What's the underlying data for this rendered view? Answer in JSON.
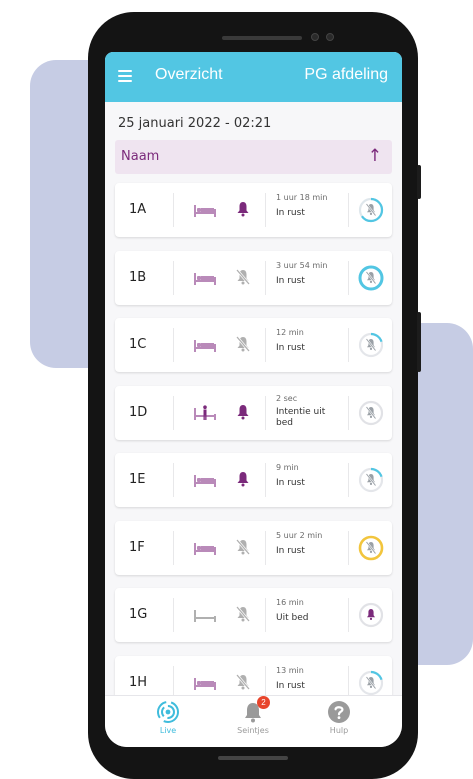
{
  "app": {
    "title": "Overzicht",
    "department": "PG afdeling"
  },
  "datetime": "25 januari 2022 - 02:21",
  "sort": {
    "label": "Naam",
    "direction_icon": "arrow-up-icon"
  },
  "colors": {
    "primary": "#52c6e3",
    "accent": "#7b2a7b",
    "ring_default": "#52c6e3",
    "ring_alert": "#f2c53d",
    "badge": "#e8452c"
  },
  "rooms": [
    {
      "name": "1A",
      "bed": "bed-occupied",
      "bell": "active",
      "duration": "1 uur 18 min",
      "status": "In rust",
      "ring": "blue-thin"
    },
    {
      "name": "1B",
      "bed": "bed-occupied",
      "bell": "muted",
      "duration": "3 uur 54 min",
      "status": "In rust",
      "ring": "blue-thick"
    },
    {
      "name": "1C",
      "bed": "bed-occupied",
      "bell": "muted",
      "duration": "12 min",
      "status": "In rust",
      "ring": "blue-partial"
    },
    {
      "name": "1D",
      "bed": "person-out-of-bed",
      "bell": "active",
      "duration": "2 sec",
      "status": "Intentie uit bed",
      "ring": "gray"
    },
    {
      "name": "1E",
      "bed": "bed-occupied",
      "bell": "active",
      "duration": "9 min",
      "status": "In rust",
      "ring": "blue-partial"
    },
    {
      "name": "1F",
      "bed": "bed-occupied",
      "bell": "muted",
      "duration": "5 uur 2 min",
      "status": "In rust",
      "ring": "yellow"
    },
    {
      "name": "1G",
      "bed": "bed-empty",
      "bell": "muted",
      "duration": "16 min",
      "status": "Uit bed",
      "ring": "gray-bell"
    },
    {
      "name": "1H",
      "bed": "bed-occupied",
      "bell": "muted",
      "duration": "13 min",
      "status": "In rust",
      "ring": "blue-partial"
    }
  ],
  "nav": [
    {
      "label": "Live",
      "icon": "live-signal-icon",
      "active": true
    },
    {
      "label": "Seintjes",
      "icon": "bell-icon",
      "badge": "2"
    },
    {
      "label": "Hulp",
      "icon": "help-icon"
    }
  ]
}
